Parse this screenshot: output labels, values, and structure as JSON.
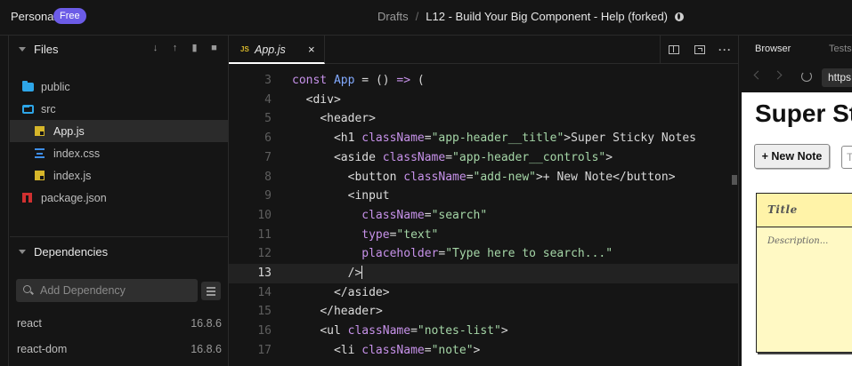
{
  "topbar": {
    "workspace": "Personal",
    "plan_badge": "Free",
    "crumb_root": "Drafts",
    "crumb_sep": "/",
    "sandbox_title": "L12 - Build Your Big Component - Help (forked)"
  },
  "explorer": {
    "title": "Files",
    "items": [
      {
        "label": "public",
        "icon": "folder-icon"
      },
      {
        "label": "src",
        "icon": "folder-open-icon"
      },
      {
        "label": "App.js",
        "icon": "js-file-icon",
        "active": true
      },
      {
        "label": "index.css",
        "icon": "css-file-icon"
      },
      {
        "label": "index.js",
        "icon": "js-file-icon"
      },
      {
        "label": "package.json",
        "icon": "npm-icon"
      }
    ]
  },
  "dependencies": {
    "title": "Dependencies",
    "search_placeholder": "Add Dependency",
    "items": [
      {
        "name": "react",
        "version": "16.8.6"
      },
      {
        "name": "react-dom",
        "version": "16.8.6"
      }
    ]
  },
  "editor": {
    "tab": {
      "badge": "JS",
      "label": "App.js",
      "close": "×"
    },
    "current_line": 13,
    "lines": [
      3,
      4,
      5,
      6,
      7,
      8,
      9,
      10,
      11,
      12,
      13,
      14,
      15,
      16,
      17
    ]
  },
  "browser": {
    "tabs": [
      "Browser",
      "Tests"
    ],
    "url": "https",
    "preview": {
      "title": "Super St",
      "new_note_button": "+ New Note",
      "search_placeholder": "T",
      "note_title": "Title",
      "note_description": "Description..."
    }
  },
  "colors": {
    "accent": "#6c5ce7",
    "background": "#151515",
    "note_yellow": "#fff9c4"
  }
}
